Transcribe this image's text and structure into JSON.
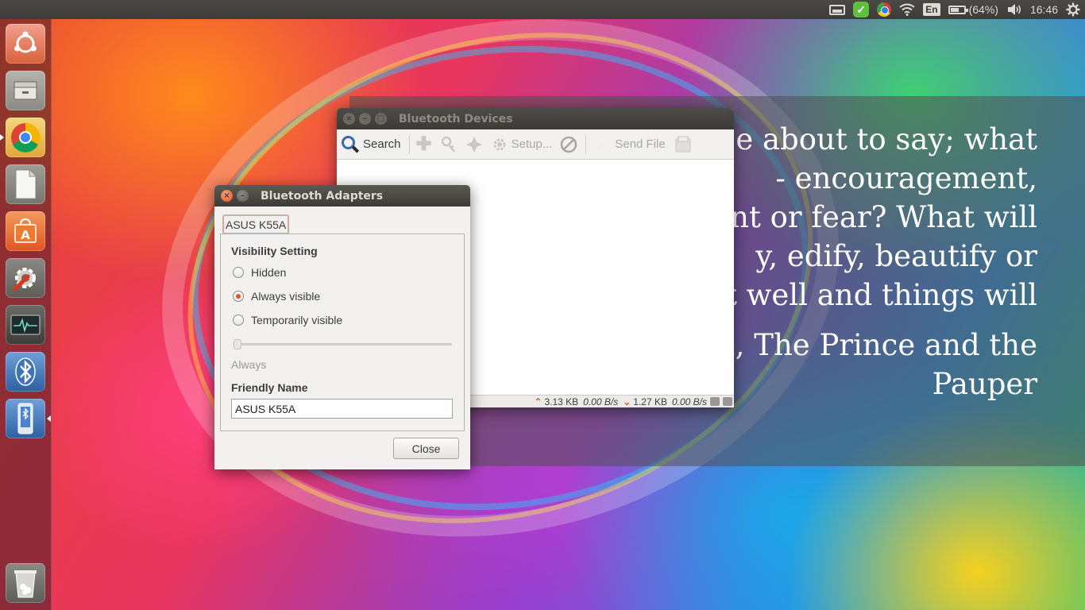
{
  "top_panel": {
    "keyboard_layout": "En",
    "battery_percent": "(64%)",
    "battery_level": 0.64,
    "clock": "16:46",
    "icons": [
      "mail-icon",
      "checkmark-icon",
      "chrome-icon",
      "wifi-icon",
      "keyboard-icon",
      "battery-icon",
      "volume-icon",
      "gear-icon"
    ]
  },
  "launcher": {
    "items": [
      "ubuntu-dash-icon",
      "files-icon",
      "chrome-icon",
      "writer-icon",
      "software-center-icon",
      "system-settings-icon",
      "system-monitor-icon",
      "bluetooth-icon",
      "usb-device-icon",
      "trash-icon"
    ]
  },
  "wallpaper_quote": {
    "lines": [
      "e about to say; what",
      "- encouragement,",
      "ent or fear? What will",
      "y, edify, beautify or",
      "t well and things will",
      "gu, The Prince and the",
      "Pauper"
    ]
  },
  "devices_window": {
    "title": "Bluetooth Devices",
    "toolbar": {
      "search": "Search",
      "setup": "Setup...",
      "send_file": "Send File"
    },
    "status": {
      "upload_total": "3.13 KB",
      "upload_rate": "0.00 B/s",
      "download_total": "1.27 KB",
      "download_rate": "0.00 B/s"
    }
  },
  "adapters_dialog": {
    "title": "Bluetooth Adapters",
    "tab_label": "ASUS K55A",
    "visibility_heading": "Visibility Setting",
    "options": {
      "hidden": "Hidden",
      "always": "Always visible",
      "temporary": "Temporarily visible"
    },
    "selected_option": "always",
    "slider_caption": "Always",
    "slider_value": 0,
    "friendly_name_heading": "Friendly Name",
    "friendly_name_value": "ASUS K55A",
    "close_label": "Close"
  },
  "colors": {
    "panel_bg": "#3c3b37",
    "accent_orange": "#e0561f",
    "dialog_bg": "#f2f1f0"
  }
}
